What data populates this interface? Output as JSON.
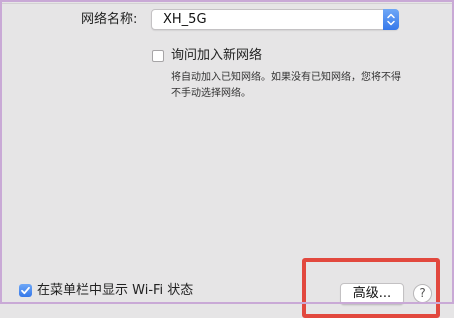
{
  "network": {
    "label": "网络名称:",
    "selected": "XH_5G",
    "stepper_icon": "chevron-up-down-icon"
  },
  "ask_to_join": {
    "checked": false,
    "label": "询问加入新网络",
    "description": "将自动加入已知网络。如果没有已知网络，您将不得不手动选择网络。"
  },
  "menu_bar_status": {
    "checked": true,
    "label": "在菜单栏中显示 Wi-Fi 状态",
    "check_icon": "checkmark-icon"
  },
  "buttons": {
    "advanced": "高级...",
    "help": "?"
  },
  "colors": {
    "accent": "#3678ea",
    "highlight": "#e2483e",
    "background": "#e6e5e6"
  }
}
